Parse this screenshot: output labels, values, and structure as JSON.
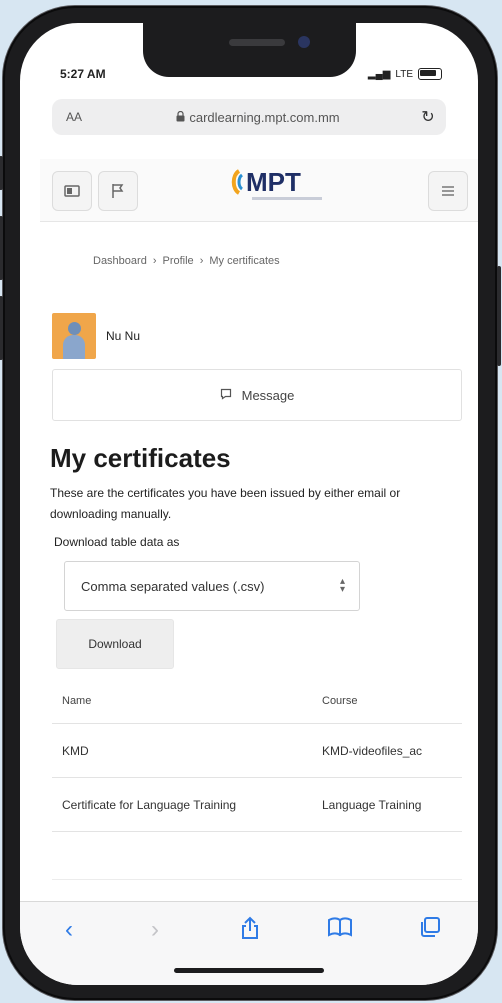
{
  "status": {
    "time": "5:27 AM",
    "signal": "LTE"
  },
  "browser": {
    "aa": "AA",
    "url": "cardlearning.mpt.com.mm"
  },
  "site": {
    "logo_text": "MPT"
  },
  "breadcrumb": [
    "Dashboard",
    "Profile",
    "My certificates"
  ],
  "breadcrumb_sep": "›",
  "user": {
    "name": "Nu Nu"
  },
  "message_button": "Message",
  "page": {
    "title": "My certificates",
    "description": "These are the certificates you have been issued by either email or downloading manually."
  },
  "download": {
    "label": "Download table data as",
    "format_selected": "Comma separated values (.csv)",
    "button": "Download"
  },
  "table": {
    "headers": [
      "Name",
      "Course"
    ],
    "rows": [
      [
        "KMD",
        "KMD-videofiles_ac"
      ],
      [
        "Certificate for Language Training",
        "Language Training"
      ]
    ]
  },
  "icons": {
    "back": "chevron-left-icon",
    "forward": "chevron-right-icon",
    "share": "share-icon",
    "bookmarks": "book-icon",
    "tabs": "tabs-icon"
  },
  "colors": {
    "accent": "#2f7be6",
    "logo": "#1f2f66",
    "avatar_bg": "#f0a64a"
  }
}
